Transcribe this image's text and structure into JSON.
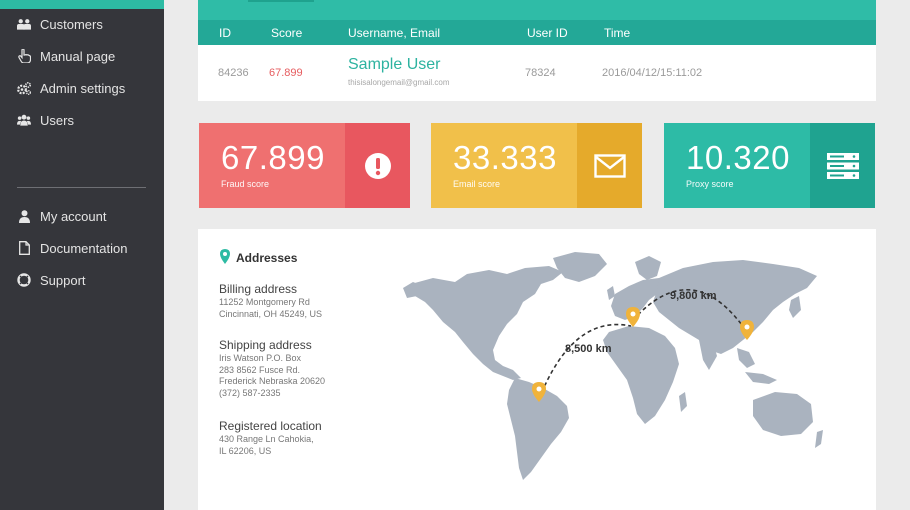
{
  "sidebar": {
    "items": [
      {
        "label": "Customers",
        "icon": "users-group-icon"
      },
      {
        "label": "Manual page",
        "icon": "hand-pointer-icon"
      },
      {
        "label": "Admin settings",
        "icon": "gears-icon"
      },
      {
        "label": "Users",
        "icon": "users-icon"
      }
    ],
    "secondary": [
      {
        "label": "My account",
        "icon": "user-icon"
      },
      {
        "label": "Documentation",
        "icon": "document-icon"
      },
      {
        "label": "Support",
        "icon": "lifebuoy-icon"
      }
    ]
  },
  "table": {
    "headers": [
      "ID",
      "Score",
      "Username, Email",
      "User ID",
      "Time"
    ],
    "row": {
      "id": "84236",
      "score": "67.899",
      "username": "Sample User",
      "email": "thisisalongemail@gmail.com",
      "user_id": "78324",
      "time": "2016/04/12/15:11:02"
    }
  },
  "scores": {
    "fraud": {
      "value": "67.899",
      "caption": "Fraud score",
      "icon": "exclamation-circle-icon"
    },
    "email": {
      "value": "33.333",
      "caption": "Email score",
      "icon": "envelope-icon"
    },
    "proxy": {
      "value": "10.320",
      "caption": "Proxy score",
      "icon": "server-icon"
    }
  },
  "addresses": {
    "title": "Addresses",
    "billing": {
      "label": "Billing address",
      "lines": [
        "11252 Montgomery Rd",
        "Cincinnati, OH 45249, US"
      ]
    },
    "shipping": {
      "label": "Shipping address",
      "lines": [
        "Iris Watson P.O. Box",
        "283 8562 Fusce Rd.",
        "Frederick Nebraska 20620",
        "(372) 587-2335"
      ]
    },
    "registered": {
      "label": "Registered location",
      "lines": [
        "430 Range Ln Cahokia,",
        "IL 62206, US"
      ]
    },
    "map": {
      "distance_1": "8,500 km",
      "distance_2": "9,800 km"
    }
  },
  "colors": {
    "accent": "#2dbba3",
    "sidebar": "#35363b",
    "fraud": "#ef7070",
    "email": "#f1c04a",
    "proxy": "#2dbba6",
    "pin": "#f0b33b",
    "land": "#aab3bf"
  }
}
